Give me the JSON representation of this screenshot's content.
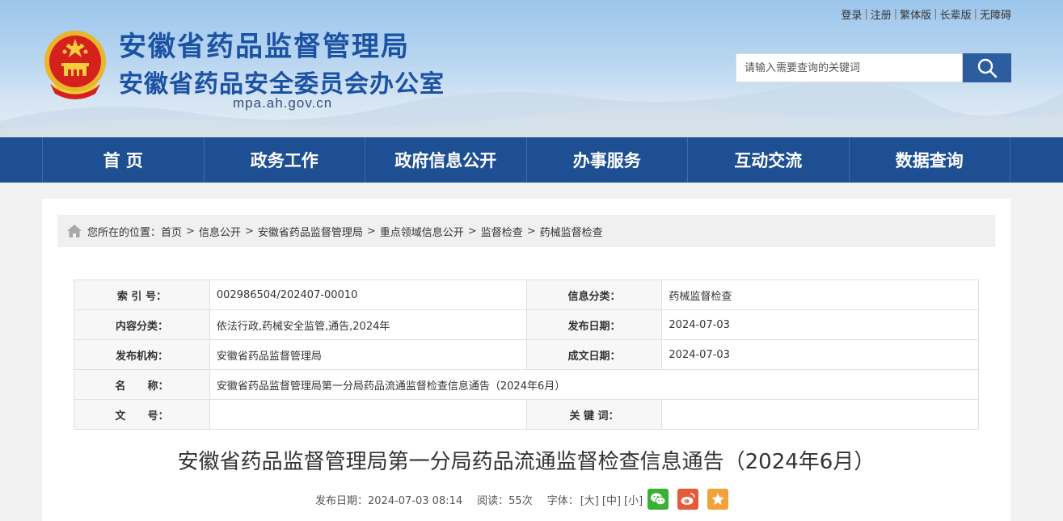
{
  "top_links": [
    "登录",
    "注册",
    "繁体版",
    "长辈版",
    "无障碍"
  ],
  "site": {
    "title_line1": "安徽省药品监督管理局",
    "title_line2": "安徽省药品安全委员会办公室",
    "domain": "mpa.ah.gov.cn"
  },
  "search": {
    "placeholder": "请输入需要查询的关键词"
  },
  "nav": [
    "首 页",
    "政务工作",
    "政府信息公开",
    "办事服务",
    "互动交流",
    "数据查询"
  ],
  "breadcrumb": {
    "prefix": "您所在的位置：",
    "items": [
      "首页",
      "信息公开",
      "安徽省药品监督管理局",
      "重点领域信息公开",
      "监督检查",
      "药械监督检查"
    ]
  },
  "meta": {
    "index_label": "索 引 号：",
    "index_value": "002986504/202407-00010",
    "category_label": "信息分类：",
    "category_value": "药械监督检查",
    "content_label": "内容分类：",
    "content_value": "依法行政,药械安全监管,通告,2024年",
    "publish_date_label": "发布日期：",
    "publish_date_value": "2024-07-03",
    "org_label": "发布机构：",
    "org_value": "安徽省药品监督管理局",
    "created_date_label": "成文日期：",
    "created_date_value": "2024-07-03",
    "name_label": "名      称：",
    "name_value": "安徽省药品监督管理局第一分局药品流通监督检查信息通告（2024年6月）",
    "docno_label": "文      号：",
    "docno_value": "",
    "keywords_label": "关 键 词：",
    "keywords_value": ""
  },
  "article": {
    "title": "安徽省药品监督管理局第一分局药品流通监督检查信息通告（2024年6月）",
    "publish": "发布日期：2024-07-03 08:14",
    "reads": "阅读：55次",
    "font_label": "字体：",
    "font_large": "[大]",
    "font_medium": "[中]",
    "font_small": "[小]"
  },
  "colors": {
    "brand": "#1d4f92",
    "title_blue": "#1c52a3"
  }
}
